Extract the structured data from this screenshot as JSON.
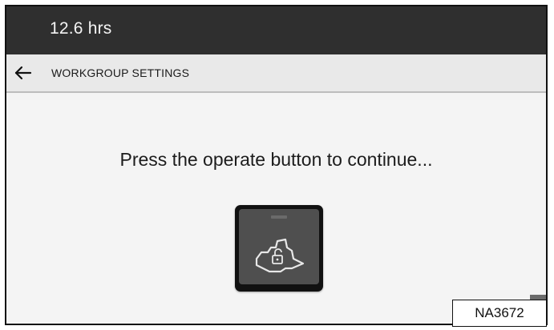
{
  "status_bar": {
    "hours": "12.6 hrs"
  },
  "nav": {
    "title": "WORKGROUP SETTINGS",
    "back_icon": "arrow-left-icon"
  },
  "main": {
    "prompt": "Press the operate button to continue...",
    "operate_button_icon": "machine-unlock-icon"
  },
  "figure": {
    "id": "NA3672"
  },
  "colors": {
    "top_bar": "#2f2f2f",
    "nav_bar": "#e9e9e9",
    "content_bg": "#f4f4f4",
    "button_dark": "#111111",
    "button_face": "#4f4f4f"
  }
}
